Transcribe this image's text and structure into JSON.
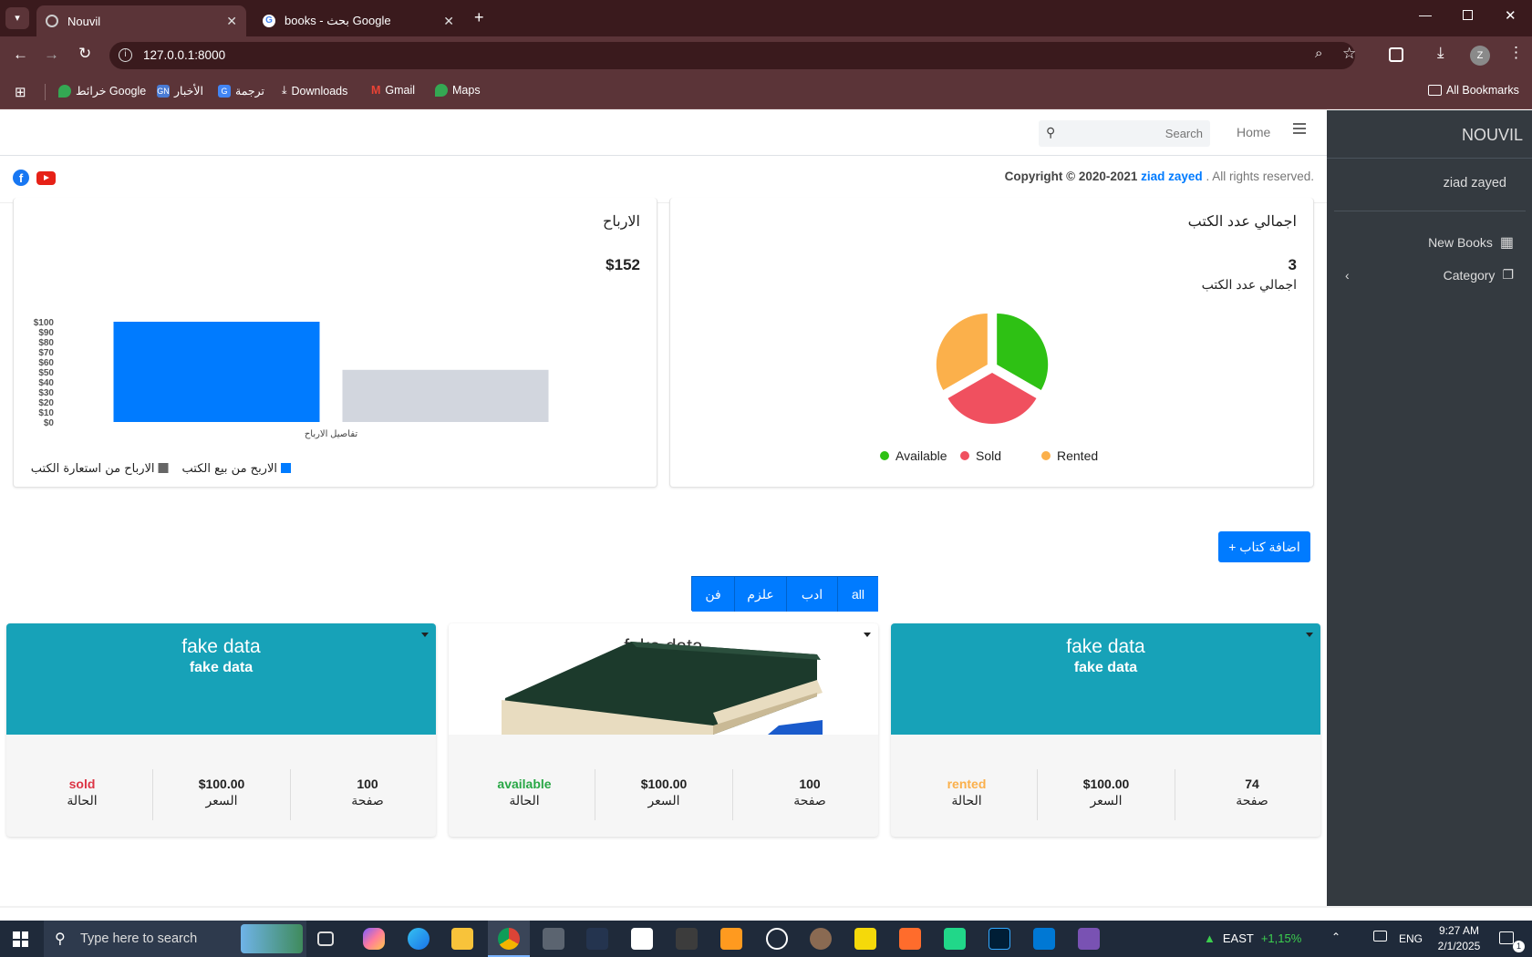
{
  "browser": {
    "tabs": [
      {
        "title": "Nouvil",
        "active": true
      },
      {
        "title": "books - بحث Google",
        "active": false
      }
    ],
    "url": "127.0.0.1:8000",
    "bookmarks": [
      "خرائط Google",
      "الأخبار",
      "ترجمة",
      "Downloads",
      "Gmail",
      "Maps"
    ],
    "all_bookmarks": "All Bookmarks",
    "profile_initial": "Z"
  },
  "sidebar": {
    "brand": "NOUVIL",
    "user": "ziad zayed",
    "items": [
      {
        "label": "New Books",
        "icon": "grid-icon"
      },
      {
        "label": "Category",
        "icon": "copy-icon"
      }
    ]
  },
  "topnav": {
    "home": "Home",
    "search_placeholder": "Search"
  },
  "footer": {
    "copyright_prefix": "Copyright © 2020-2021",
    "author": "ziad zayed",
    "suffix": ". All rights reserved."
  },
  "books_total_card": {
    "title": "اجمالي عدد الكتب",
    "count": "3",
    "count_label": "اجمالي عدد الكتب",
    "chart_data": {
      "type": "pie",
      "labels": [
        "Available",
        "Sold",
        "Rented"
      ],
      "values": [
        1,
        1,
        1
      ],
      "colors": [
        "#2ec114",
        "#f0505f",
        "#fbb04b"
      ],
      "legend": "bottom"
    }
  },
  "profit_card": {
    "title": "الارباح",
    "amount": "$152",
    "chart_data": {
      "type": "bar",
      "categories": [
        "تفاصيل الارباح"
      ],
      "series": [
        {
          "name": "الاربح من بيع الكتب",
          "values": [
            100
          ],
          "color": "#007bff"
        },
        {
          "name": "الارباح من استعارة الكتب",
          "values": [
            52
          ],
          "color": "#d2d6de"
        }
      ],
      "yticks": [
        "$100",
        "$90",
        "$80",
        "$70",
        "$60",
        "$50",
        "$40",
        "$30",
        "$20",
        "$10",
        "$0"
      ],
      "ylim": [
        0,
        100
      ],
      "legend": "bottom-left"
    }
  },
  "add_book_button": "+ اضافة كتاب",
  "filters": [
    "all",
    "ادب",
    "علزم",
    "فن"
  ],
  "books": [
    {
      "title": "fake data",
      "subtitle": "fake data",
      "pages": "74",
      "pages_label": "صفحة",
      "price": "$100.00",
      "price_label": "السعر",
      "status": "rented",
      "status_label": "الحالة",
      "status_color": "#fbb04b",
      "image": false
    },
    {
      "title": "fake data",
      "subtitle": "",
      "pages": "100",
      "pages_label": "صفحة",
      "price": "$100.00",
      "price_label": "السعر",
      "status": "available",
      "status_label": "الحالة",
      "status_color": "#28a745",
      "image": true
    },
    {
      "title": "fake data",
      "subtitle": "fake data",
      "pages": "100",
      "pages_label": "صفحة",
      "price": "$100.00",
      "price_label": "السعر",
      "status": "sold",
      "status_label": "الحالة",
      "status_color": "#dc3545",
      "image": false
    }
  ],
  "taskbar": {
    "search_placeholder": "Type here to search",
    "weather": "EAST",
    "market": "+1,15%",
    "lang": "ENG",
    "time": "9:27 AM",
    "date": "2/1/2025",
    "notifications": "1"
  }
}
